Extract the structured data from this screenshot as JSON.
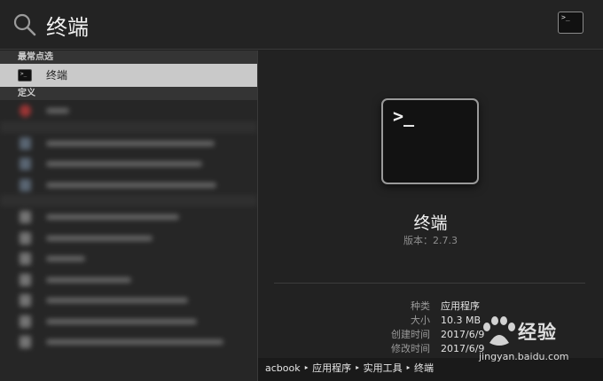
{
  "search": {
    "query": "终端",
    "icon": "search-icon"
  },
  "top_icon": {
    "glyph": ">_",
    "icon": "terminal-icon"
  },
  "results": {
    "top_hit_header": "最常点选",
    "top_hit_label": "终端",
    "definition_header": "定义"
  },
  "preview": {
    "prompt_glyph": ">_",
    "app_name": "终端",
    "version": "版本：2.7.3",
    "info": [
      {
        "key": "种类",
        "value": "应用程序"
      },
      {
        "key": "大小",
        "value": "10.3 MB"
      },
      {
        "key": "创建时间",
        "value": "2017/6/9"
      },
      {
        "key": "修改时间",
        "value": "2017/6/9"
      }
    ],
    "path": "acbook ‣ 应用程序 ‣ 实用工具 ‣ 终端"
  },
  "watermark": {
    "logo_text": "经验",
    "url": "jingyan.baidu.com"
  },
  "colors": {
    "selected_row": "#c9c9c9",
    "background": "#1f1f1f"
  }
}
